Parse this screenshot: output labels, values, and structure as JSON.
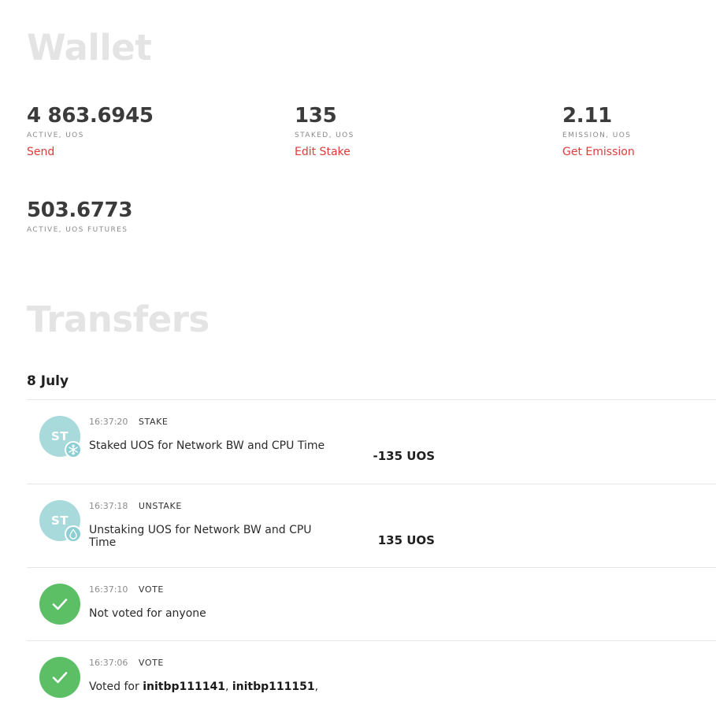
{
  "wallet": {
    "title": "Wallet",
    "stats": [
      {
        "value": "4 863.6945",
        "label": "ACTIVE, UOS",
        "action": "Send"
      },
      {
        "value": "135",
        "label": "STAKED, UOS",
        "action": "Edit Stake"
      },
      {
        "value": "2.11",
        "label": "EMISSION, UOS",
        "action": "Get Emission"
      },
      {
        "value": "503.6773",
        "label": "ACTIVE, UOS FUTURES"
      }
    ]
  },
  "transfers": {
    "title": "Transfers",
    "date": "8 July",
    "items": [
      {
        "avatar": "ST",
        "badge_icon": "snowflake-icon",
        "time": "16:37:20",
        "type": "STAKE",
        "description": "Staked UOS for Network BW and CPU Time",
        "amount": "-135 UOS"
      },
      {
        "avatar": "ST",
        "badge_icon": "water-drop-icon",
        "time": "16:37:18",
        "type": "UNSTAKE",
        "description": "Unstaking UOS for Network BW and CPU Time",
        "amount": "135 UOS"
      },
      {
        "icon": "checkmark-icon",
        "time": "16:37:10",
        "type": "VOTE",
        "description": "Not voted for anyone"
      },
      {
        "icon": "checkmark-icon",
        "time": "16:37:06",
        "type": "VOTE",
        "description_prefix": "Voted for ",
        "voted_1": "initbp111141",
        "sep": ", ",
        "voted_2": "initbp111151",
        "suffix": ","
      }
    ]
  },
  "colors": {
    "accent_red": "#e03a3a",
    "avatar_teal": "#a8dadc",
    "vote_green": "#5cbf66",
    "heading_gray": "#e4e4e4"
  }
}
